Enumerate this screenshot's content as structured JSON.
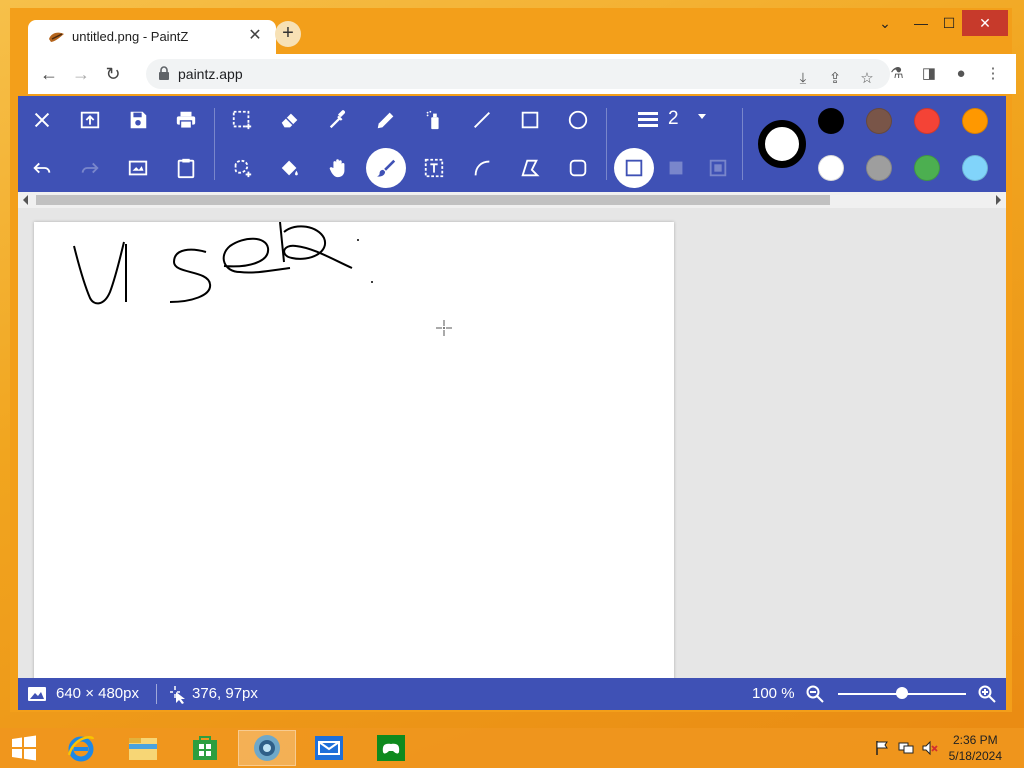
{
  "browser": {
    "tab_title": "untitled.png - PaintZ",
    "tab_close": "✕",
    "new_tab": "+",
    "url": "paintz.app",
    "window_controls": {
      "chevron": "⌄",
      "minimize": "—",
      "maximize": "☐",
      "close": "✕"
    }
  },
  "toolbar": {
    "line_width": "2",
    "colors": {
      "current": "#000000",
      "palette": [
        "#000000",
        "#795548",
        "#f44336",
        "#ff9800",
        "#ffffff",
        "#9e9e9e",
        "#4caf50",
        "#81d4fa"
      ]
    }
  },
  "status": {
    "image_size": "640 × 480px",
    "cursor_pos": "376, 97px",
    "zoom": "100 %"
  },
  "taskbar": {
    "time": "2:36 PM",
    "date": "5/18/2024"
  },
  "icons": {
    "toolbar_row1": [
      "close-icon",
      "open-icon",
      "save-icon",
      "print-icon",
      "rect-select-icon",
      "eraser-icon",
      "eyedropper-icon",
      "pencil-icon",
      "airbrush-icon",
      "line-icon",
      "rectangle-icon",
      "ellipse-icon"
    ],
    "toolbar_row2": [
      "undo-icon",
      "redo-icon",
      "resize-icon",
      "paste-icon",
      "freeform-select-icon",
      "fill-icon",
      "pan-icon",
      "brush-icon",
      "text-icon",
      "curve-icon",
      "polygon-icon",
      "rounded-rect-icon"
    ]
  }
}
